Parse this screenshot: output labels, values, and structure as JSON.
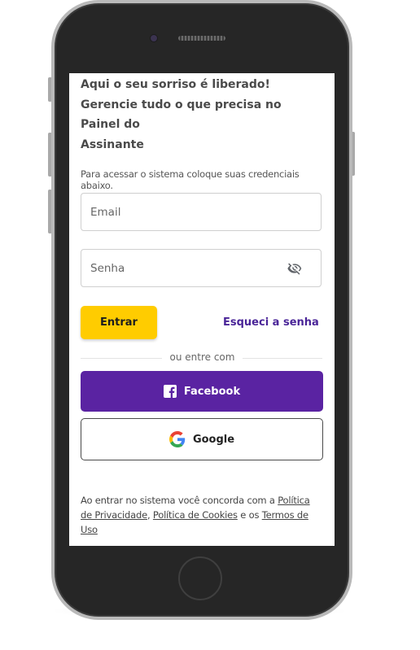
{
  "headline": {
    "line1": "Aqui o seu sorriso é liberado!",
    "line2": "Gerencie tudo o que precisa no Painel do",
    "line3": "Assinante"
  },
  "hint": "Para acessar o sistema coloque suas credenciais abaixo.",
  "form": {
    "email_placeholder": "Email",
    "email_value": "",
    "password_placeholder": "Senha",
    "password_value": ""
  },
  "actions": {
    "login_label": "Entrar",
    "forgot_label": "Esqueci a senha"
  },
  "divider": "ou entre com",
  "social": {
    "facebook_label": "Facebook",
    "google_label": "Google"
  },
  "terms": {
    "prefix": "Ao entrar no sistema você concorda com a ",
    "privacy_link": "Política de Privacidade",
    "sep": ", ",
    "cookies_link": "Política de Cookies",
    "and": " e os ",
    "terms_link": "Termos de Uso"
  },
  "icons": {
    "password_toggle": "eye-off-icon",
    "facebook": "facebook-icon",
    "google": "google-icon"
  },
  "colors": {
    "primary_yellow": "#ffcc00",
    "brand_purple": "#5a23a2",
    "link_purple": "#4a2598"
  }
}
